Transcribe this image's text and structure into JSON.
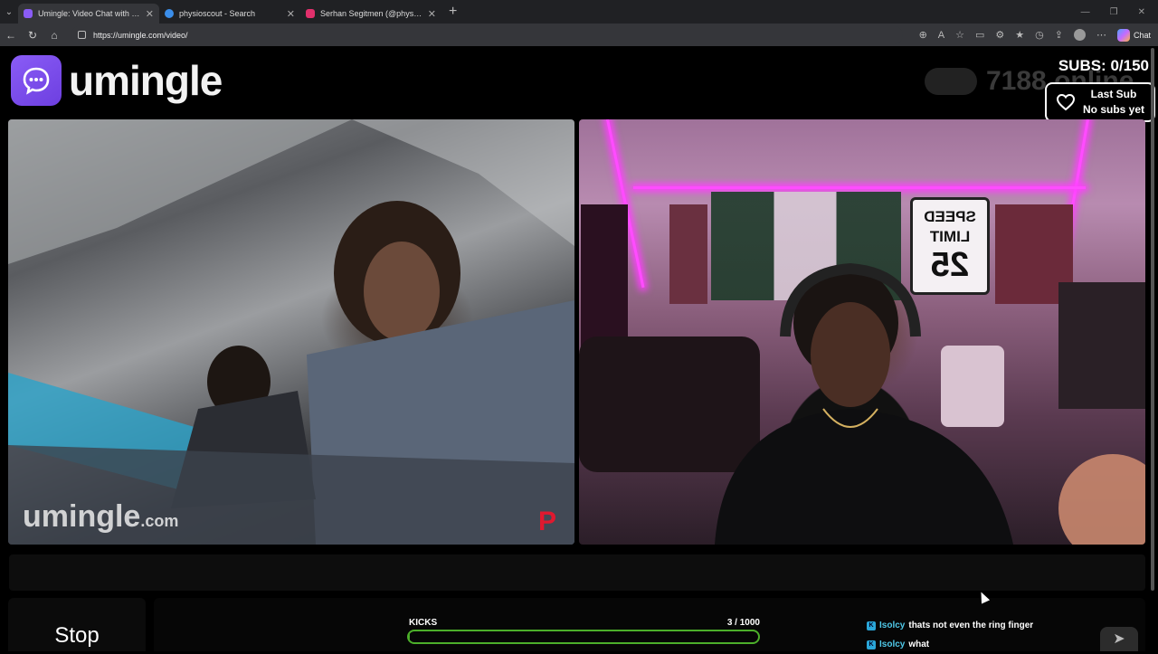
{
  "browser": {
    "tabs": [
      {
        "title": "Umingle: Video Chat with Stra",
        "active": true,
        "favicon_color": "#c44dff"
      },
      {
        "title": "physioscout - Search",
        "active": false,
        "favicon_color": "#3b8eea"
      },
      {
        "title": "Serhan Segitmen (@physioscout)",
        "active": false,
        "favicon_color": "#e1306c"
      }
    ],
    "url": "https://umingle.com/video/",
    "chat_button": "Chat"
  },
  "site": {
    "logo_text": "umingle",
    "online_count": "7188 online",
    "subs": "SUBS: 0/150",
    "last_sub_title": "Last Sub",
    "last_sub_value": "No subs yet",
    "watermark": "umingle",
    "watermark_suffix": ".com",
    "sign_top": "SPEED",
    "sign_mid": "LIMIT",
    "sign_num": "25"
  },
  "controls": {
    "stop_label": "Stop",
    "kicks_label": "KICKS",
    "kicks_current": 3,
    "kicks_max": 1000,
    "kicks_text": "3  / 1000"
  },
  "chat": [
    {
      "user": "Isolcy",
      "message": "thats not even the ring finger"
    },
    {
      "user": "Isolcy",
      "message": "what"
    }
  ],
  "colors": {
    "accent": "#8a5cf6",
    "kicks": "#4caf2a",
    "led": "#ff4cff"
  }
}
